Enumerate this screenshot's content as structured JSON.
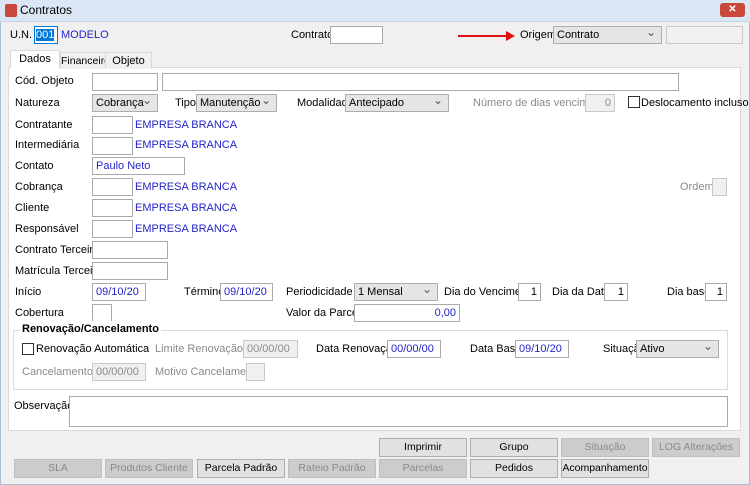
{
  "window": {
    "title": "Contratos",
    "close_icon": "close-icon",
    "accent": "#c8483c"
  },
  "header": {
    "un_label": "U.N.",
    "un_value": "001",
    "un_name": "MODELO",
    "contrato_label": "Contrato",
    "contrato_value": "",
    "origem_label": "Origem",
    "origem_value": "Contrato",
    "origem_extra": ""
  },
  "tabs": [
    {
      "label": "Dados"
    },
    {
      "label": "Financeiro"
    },
    {
      "label": "Objeto"
    }
  ],
  "form": {
    "cod_objeto_label": "Cód. Objeto",
    "cod_objeto": "",
    "cod_objeto_desc": "",
    "natureza_label": "Natureza",
    "natureza": "Cobrança",
    "tipo_label": "Tipo",
    "tipo": "Manutenção",
    "modalidade_label": "Modalidade",
    "modalidade": "Antecipado",
    "num_dias_label": "Número de dias vencimento",
    "num_dias": "0",
    "deslocamento_label": "Deslocamento incluso",
    "contratante_label": "Contratante",
    "contratante_name": "EMPRESA BRANCA",
    "intermediaria_label": "Intermediária",
    "intermediaria_name": "EMPRESA BRANCA",
    "contato_label": "Contato",
    "contato": "Paulo Neto",
    "cobranca_label": "Cobrança",
    "cobranca_name": "EMPRESA BRANCA",
    "ordem_label": "Ordem",
    "cliente_label": "Cliente",
    "cliente_name": "EMPRESA BRANCA",
    "responsavel_label": "Responsável",
    "responsavel_name": "EMPRESA BRANCA",
    "contrato_terceiro_label": "Contrato Terceiro",
    "matricula_terceiro_label": "Matrícula Terceiro",
    "inicio_label": "Início",
    "inicio": "09/10/20",
    "termino_label": "Término",
    "termino": "09/10/20",
    "periodicidade_label": "Periodicidade",
    "periodicidade": "1 Mensal",
    "dia_venc_label": "Dia do Vencimento",
    "dia_venc": "1",
    "dia_data_label": "Dia da Data",
    "dia_data": "1",
    "dia_base_label": "Dia base",
    "dia_base": "1",
    "cobertura_label": "Cobertura",
    "valor_parcela_label": "Valor da Parcela",
    "valor_parcela": "0,00",
    "observacao_label": "Observação"
  },
  "renovacao": {
    "title": "Renovação/Cancelamento",
    "auto_label": "Renovação Automática",
    "limite_label": "Limite Renovação",
    "limite": "00/00/00",
    "data_renov_label": "Data Renovação",
    "data_renov": "00/00/00",
    "data_base_label": "Data Base",
    "data_base": "09/10/20",
    "situacao_label": "Situação",
    "situacao": "Ativo",
    "cancelamento_label": "Cancelamento",
    "cancelamento": "00/00/00",
    "motivo_label": "Motivo Cancelamento"
  },
  "buttons": {
    "imprimir": "Imprimir",
    "grupo": "Grupo",
    "sit_fin": "Situação Financeira",
    "log": "LOG Alterações",
    "sla": "SLA",
    "produtos": "Produtos Cliente",
    "parcela_padrao": "Parcela Padrão",
    "rateio": "Rateio Padrão",
    "parcelas": "Parcelas",
    "pedidos": "Pedidos",
    "acompanhamento": "Acompanhamento"
  }
}
